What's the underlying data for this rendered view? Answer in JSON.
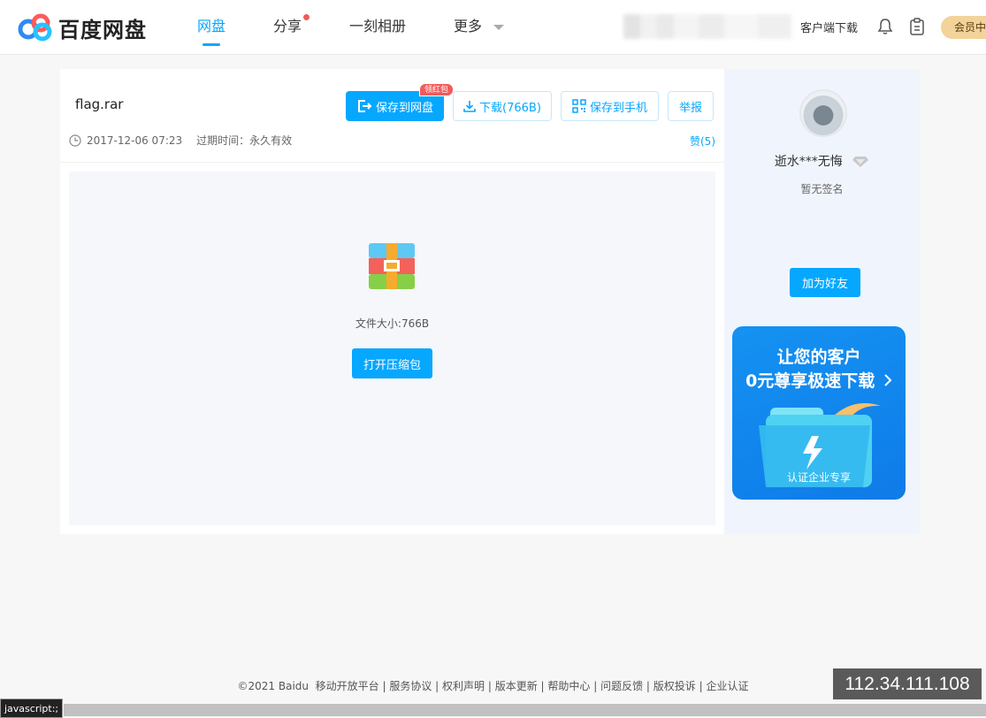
{
  "header": {
    "logo_text": "百度网盘",
    "nav": [
      {
        "label": "网盘",
        "active": true
      },
      {
        "label": "分享",
        "badge_dot": true
      },
      {
        "label": "一刻相册"
      },
      {
        "label": "更多"
      }
    ],
    "client_download": "客户端下载",
    "vip_label": "会员中"
  },
  "file": {
    "name": "flag.rar",
    "save_label": "保存到网盘",
    "hongbao_badge": "领红包",
    "download_label": "下载(766B)",
    "save_phone_label": "保存到手机",
    "report_label": "举报",
    "date": "2017-12-06 07:23",
    "expire": "过期时间：永久有效",
    "like": "赞(5)",
    "size_text": "文件大小:766B",
    "open_label": "打开压缩包"
  },
  "sidebar": {
    "username": "逝水***无悔",
    "signature": "暂无签名",
    "add_friend": "加为好友",
    "ad": {
      "line1": "让您的客户",
      "line2": "0元尊享极速下载",
      "footer": "认证企业专享"
    }
  },
  "footer": {
    "copyright": "©2021 Baidu",
    "links": [
      "移动开放平台",
      "服务协议",
      "权利声明",
      "版本更新",
      "帮助中心",
      "问题反馈",
      "版权投诉",
      "企业认证"
    ]
  },
  "overlay": {
    "ip": "112.34.111.108",
    "status_text": "javascript:;"
  },
  "colors": {
    "accent": "#06a7ff",
    "hongbao": "#f25b5b",
    "vip": "#f2d39a"
  }
}
